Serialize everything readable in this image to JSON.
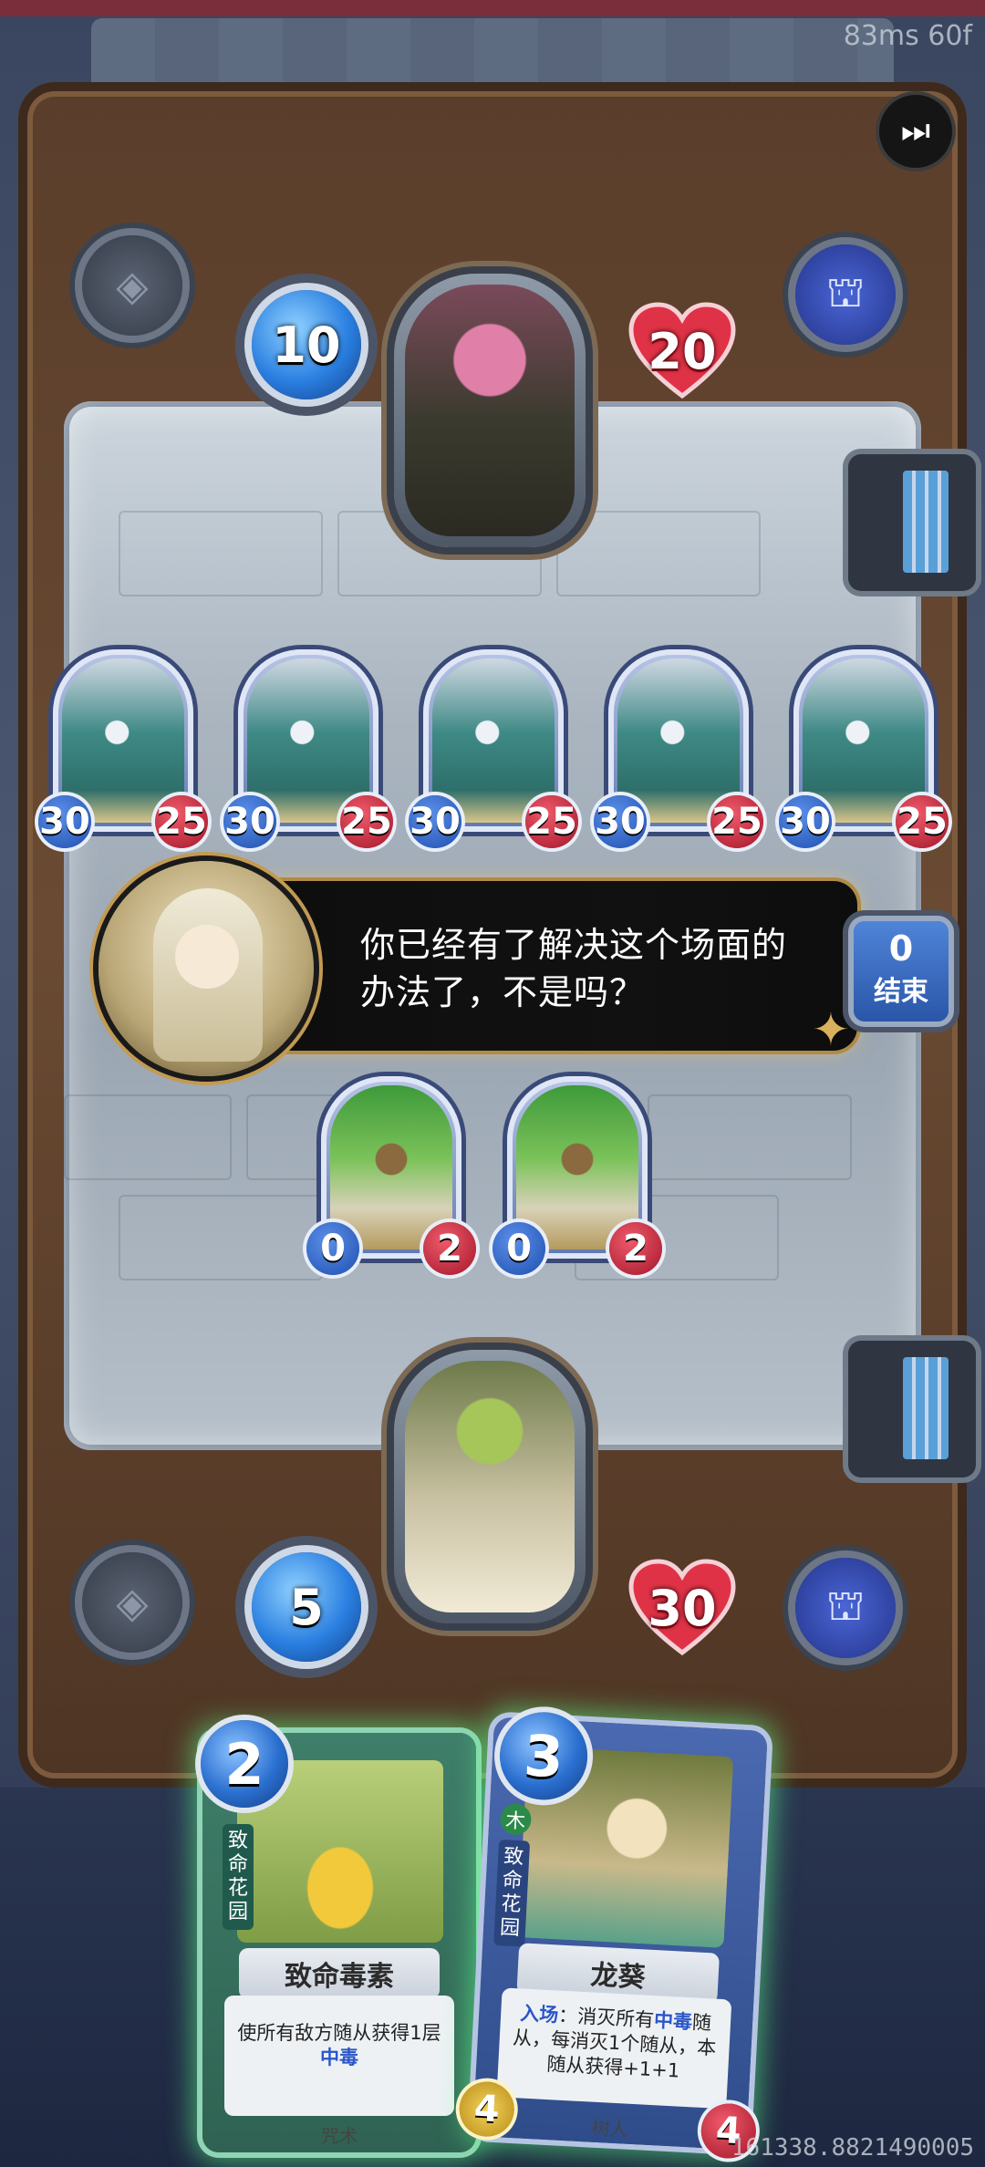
{
  "perf": "83ms 60f",
  "build_id": "161338.8821490005",
  "enemy": {
    "mana": "10",
    "health": "20"
  },
  "player": {
    "mana": "5",
    "health": "30"
  },
  "enemy_minions": [
    {
      "attack": "30",
      "health": "25"
    },
    {
      "attack": "30",
      "health": "25"
    },
    {
      "attack": "30",
      "health": "25"
    },
    {
      "attack": "30",
      "health": "25"
    },
    {
      "attack": "30",
      "health": "25"
    }
  ],
  "player_minions": [
    {
      "attack": "0",
      "health": "2"
    },
    {
      "attack": "0",
      "health": "2"
    }
  ],
  "dialog": {
    "line1": "你已经有了解决这个场面的",
    "line2": "办法了，不是吗？"
  },
  "end_turn": {
    "count": "0",
    "label": "结束"
  },
  "hand": [
    {
      "cost": "2",
      "set": "致命花园",
      "name": "致命毒素",
      "desc_prefix": "使所有敌方随从获得1层",
      "desc_keyword": "中毒",
      "type": "咒术"
    },
    {
      "cost": "3",
      "element": "木",
      "set": "致命花园",
      "name": "龙葵",
      "desc_keyword1": "入场",
      "desc_text1": "：消灭所有",
      "desc_keyword2": "中毒",
      "desc_text2": "随从，每消灭1个随从，本随从获得+1+1",
      "type": "树人",
      "attack": "4",
      "health": "4"
    }
  ],
  "colors": {
    "mana": "#2a7fe0",
    "health": "#d62a3c",
    "card_spell_border": "#2fa872",
    "card_minion_border": "#3a5fae",
    "glow": "#5dff8a"
  }
}
